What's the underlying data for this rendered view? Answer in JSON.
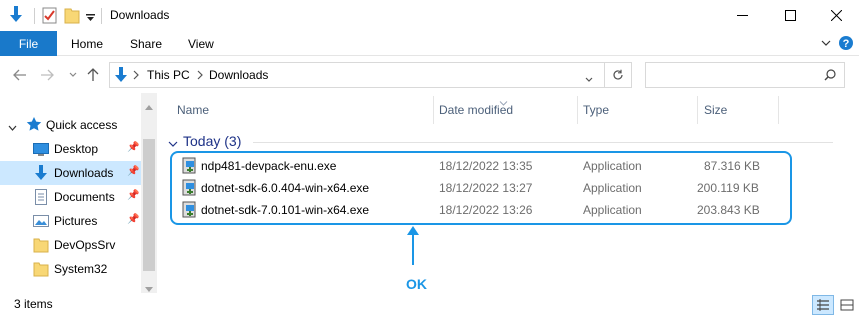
{
  "window": {
    "title": "Downloads",
    "minimize_label": "—",
    "maximize_label": "☐",
    "close_label": "✕"
  },
  "ribbon": {
    "tabs": [
      "File",
      "Home",
      "Share",
      "View"
    ]
  },
  "address": {
    "segments": [
      "This PC",
      "Downloads"
    ],
    "search_placeholder": ""
  },
  "nav": {
    "items": [
      {
        "label": "Quick access"
      },
      {
        "label": "Desktop"
      },
      {
        "label": "Downloads"
      },
      {
        "label": "Documents"
      },
      {
        "label": "Pictures"
      },
      {
        "label": "DevOpsSrv"
      },
      {
        "label": "System32"
      }
    ]
  },
  "list": {
    "columns": [
      "Name",
      "Date modified",
      "Type",
      "Size"
    ],
    "group_label": "Today (3)",
    "rows": [
      {
        "name": "ndp481-devpack-enu.exe",
        "date": "18/12/2022 13:35",
        "type": "Application",
        "size": "87.316 KB"
      },
      {
        "name": "dotnet-sdk-6.0.404-win-x64.exe",
        "date": "18/12/2022 13:27",
        "type": "Application",
        "size": "200.119 KB"
      },
      {
        "name": "dotnet-sdk-7.0.101-win-x64.exe",
        "date": "18/12/2022 13:26",
        "type": "Application",
        "size": "203.843 KB"
      }
    ]
  },
  "annotation": {
    "label": "OK"
  },
  "status": {
    "item_count": "3 items"
  },
  "colors": {
    "accent": "#1979ca",
    "annotation": "#1a96e6",
    "selected": "#cce8ff"
  }
}
